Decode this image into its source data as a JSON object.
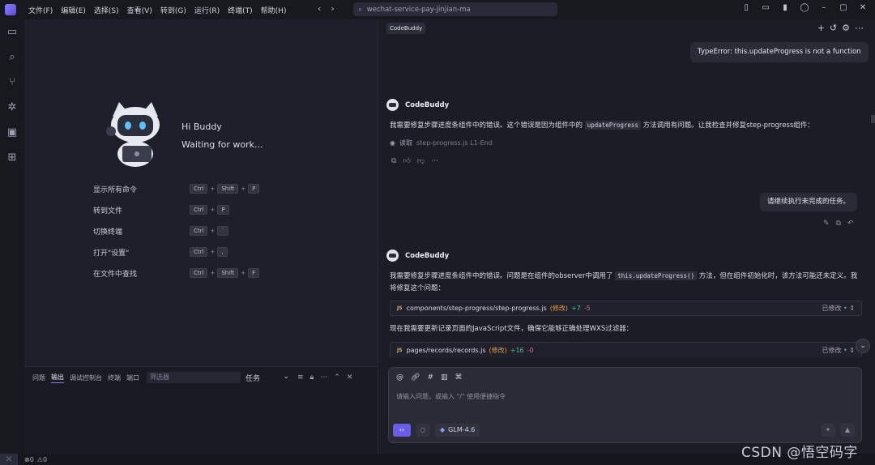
{
  "menu": [
    "文件(F)",
    "编辑(E)",
    "选择(S)",
    "查看(V)",
    "转到(G)",
    "运行(R)",
    "终端(T)",
    "帮助(H)"
  ],
  "search": {
    "text": "wechat-service-pay-jinjian-ma"
  },
  "welcome": {
    "greeting": "Hi Buddy",
    "status": "Waiting for work..."
  },
  "shortcuts": [
    {
      "label": "显示所有命令",
      "keys": [
        "Ctrl",
        "Shift",
        "P"
      ]
    },
    {
      "label": "转到文件",
      "keys": [
        "Ctrl",
        "P"
      ]
    },
    {
      "label": "切换终端",
      "keys": [
        "Ctrl",
        "`"
      ]
    },
    {
      "label": "打开\"设置\"",
      "keys": [
        "Ctrl",
        ","
      ]
    },
    {
      "label": "在文件中查找",
      "keys": [
        "Ctrl",
        "Shift",
        "F"
      ]
    }
  ],
  "panel": {
    "tabs": [
      "问题",
      "输出",
      "调试控制台",
      "终端",
      "端口"
    ],
    "filter_placeholder": "筛选器",
    "dropdown": "任务"
  },
  "chat": {
    "tag": "CodeBuddy",
    "user_msg_1": "TypeError: this.updateProgress is not a function",
    "ai_name": "CodeBuddy",
    "reply1_pre": "我需要修复步骤进度条组件中的错误。这个错误是因为组件中的",
    "reply1_code": "updateProgress",
    "reply1_post": "方法调用有问题。让我检查并修复step-progress组件：",
    "read_label": "读取",
    "read_file": "step-progress.js L1-End",
    "user_msg_2": "请继续执行未完成的任务。",
    "reply2_pre": "我需要修复步骤进度条组件中的错误。问题是在组件的observer中调用了",
    "reply2_code": "this.updateProgress()",
    "reply2_post": "方法，但在组件初始化时，该方法可能还未定义。我将修复这个问题：",
    "file1": {
      "path": "components/step-progress/step-progress.js",
      "mod": "(修改)",
      "add": "+7",
      "del": "-5",
      "status": "已修改"
    },
    "reply3": "现在我需要更新记录页面的JavaScript文件，确保它能够正确处理WXS过滤器：",
    "file2": {
      "path": "pages/records/records.js",
      "mod": "(修改)",
      "add": "+16",
      "del": "-0",
      "status": "已修改"
    },
    "input_placeholder": "请输入问题，或输入 \"/\" 使用便捷指令",
    "model": "GLM-4.6"
  },
  "status": {
    "errors": "0",
    "warnings": "0"
  },
  "watermark": "CSDN @悟空码字"
}
